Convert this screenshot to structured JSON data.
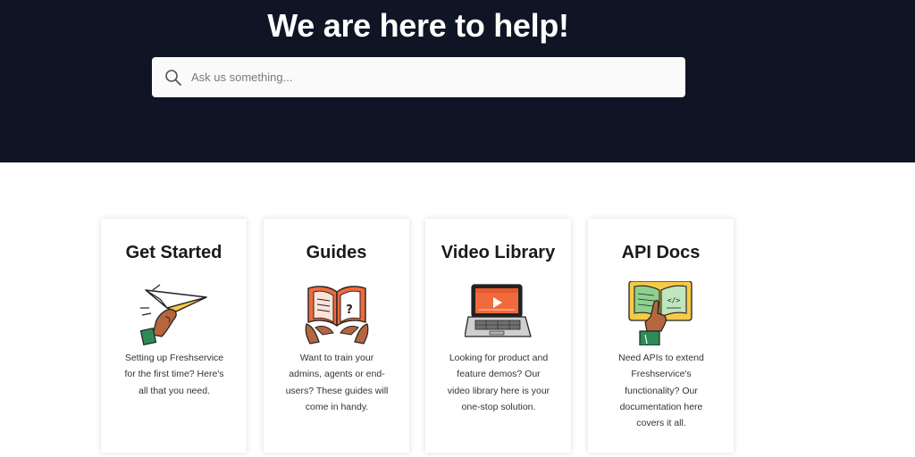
{
  "hero": {
    "title": "We are here to help!",
    "search_placeholder": "Ask us something..."
  },
  "cards": [
    {
      "title": "Get Started",
      "description": "Setting up Freshservice for the first time? Here's all that you need.",
      "icon": "paper-plane-hand-icon"
    },
    {
      "title": "Guides",
      "description": "Want to train your admins, agents or end-users? These guides will come in handy.",
      "icon": "open-book-hands-icon"
    },
    {
      "title": "Video Library",
      "description": "Looking for product and feature demos? Our video library here is your one-stop solution.",
      "icon": "laptop-video-icon"
    },
    {
      "title": "API Docs",
      "description": "Need APIs to extend Freshservice's functionality? Our documentation here covers it all.",
      "icon": "api-book-pointer-icon"
    }
  ],
  "colors": {
    "hero_bg": "#0f1524",
    "accent_orange": "#f06a3c",
    "accent_yellow": "#f7c948",
    "accent_green": "#2e8b57",
    "skin": "#b5663f"
  }
}
